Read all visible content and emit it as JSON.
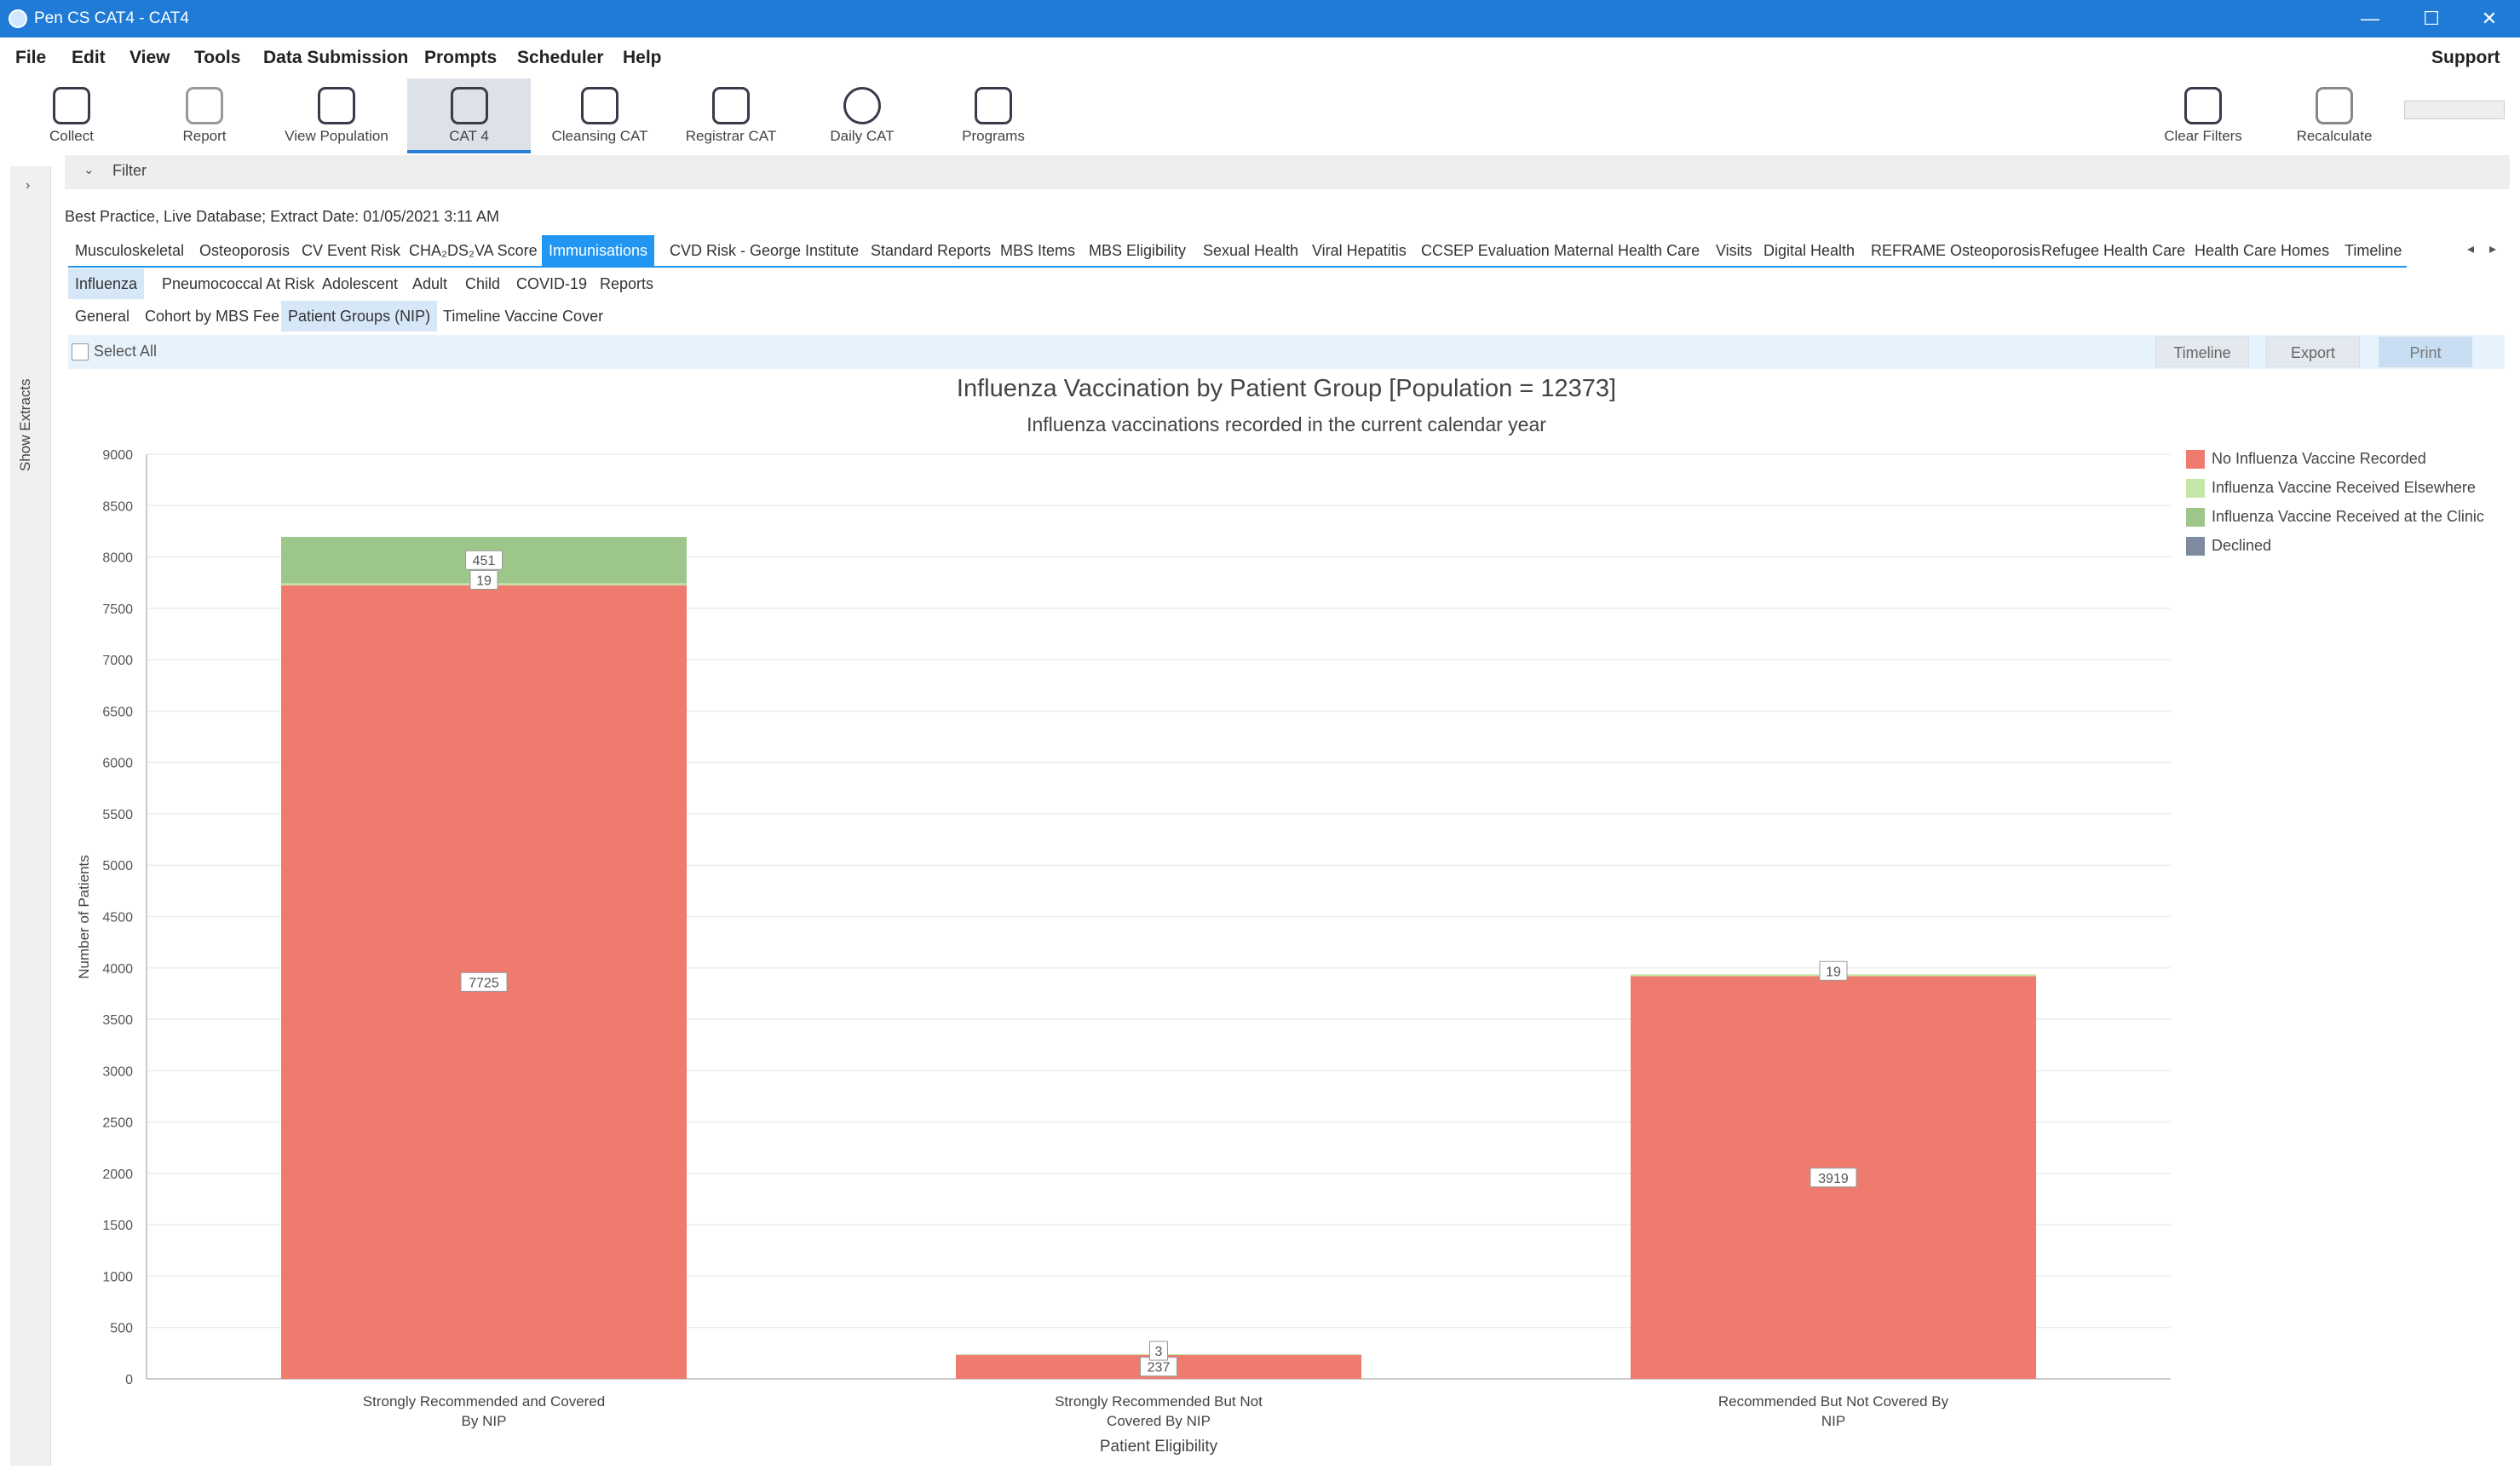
{
  "window": {
    "title": "Pen CS CAT4 - CAT4",
    "minimize": "—",
    "maximize": "☐",
    "close": "✕"
  },
  "menu": {
    "items": [
      "File",
      "Edit",
      "View",
      "Tools",
      "Data Submission",
      "Prompts",
      "Scheduler",
      "Help"
    ],
    "support": "Support"
  },
  "toolbar": {
    "tools": [
      {
        "label": "Collect",
        "icon": "cart-icon"
      },
      {
        "label": "Report",
        "icon": "report-icon"
      },
      {
        "label": "View Population",
        "icon": "population-icon"
      },
      {
        "label": "CAT 4",
        "icon": "cat4-icon",
        "active": true
      },
      {
        "label": "Cleansing CAT",
        "icon": "cleansing-icon"
      },
      {
        "label": "Registrar CAT",
        "icon": "registrar-icon"
      },
      {
        "label": "Daily CAT",
        "icon": "daily-cat-icon"
      },
      {
        "label": "Programs",
        "icon": "programs-icon"
      }
    ],
    "right_tools": [
      {
        "label": "Clear Filters",
        "icon": "eraser-icon"
      },
      {
        "label": "Recalculate",
        "icon": "calculator-icon"
      }
    ]
  },
  "sidebar": {
    "show_extracts": "Show Extracts",
    "arrow": "›"
  },
  "filter": {
    "label": "Filter",
    "chevron": "⌄"
  },
  "extract_info": "Best Practice, Live Database; Extract Date: 01/05/2021 3:11 AM",
  "tabs_main": [
    "Musculoskeletal",
    "Osteoporosis",
    "CV Event Risk",
    "CHA₂DS₂VA Score",
    "Immunisations",
    "CVD Risk - George Institute",
    "Standard Reports",
    "MBS Items",
    "MBS Eligibility",
    "Sexual Health",
    "Viral Hepatitis",
    "CCSEP Evaluation",
    "Maternal Health Care",
    "Visits",
    "Digital Health",
    "REFRAME Osteoporosis",
    "Refugee Health Care",
    "Health Care Homes",
    "Timeline"
  ],
  "tabs_main_active": "Immunisations",
  "tabs_main_nav": {
    "prev": "◂",
    "next": "▸"
  },
  "tabs_imm": [
    "Influenza",
    "Pneumococcal At Risk",
    "Adolescent",
    "Adult",
    "Child",
    "COVID-19",
    "Reports"
  ],
  "tabs_imm_active": "Influenza",
  "tabs_flu": [
    "General",
    "Cohort by MBS Fee",
    "Patient Groups (NIP)",
    "Timeline Vaccine Cover"
  ],
  "tabs_flu_active": "Patient Groups (NIP)",
  "actions": {
    "select_all": "Select All",
    "timeline": "Timeline",
    "export": "Export",
    "print": "Print"
  },
  "colors": {
    "no_vaccine": "#ef7b6f",
    "elsewhere": "#c4e7a8",
    "at_clinic": "#9dc68a",
    "declined": "#7d8aa0",
    "accent": "#2196f3"
  },
  "chart_data": {
    "type": "bar",
    "stacked": true,
    "title": "Influenza Vaccination by Patient Group [Population = 12373]",
    "subtitle": "Influenza vaccinations recorded in the current calendar year",
    "xlabel": "Patient Eligibility",
    "ylabel": "Number of Patients",
    "ylim": [
      0,
      9000
    ],
    "yticks": [
      0,
      500,
      1000,
      1500,
      2000,
      2500,
      3000,
      3500,
      4000,
      4500,
      5000,
      5500,
      6000,
      6500,
      7000,
      7500,
      8000,
      8500,
      9000
    ],
    "grid": true,
    "legend_position": "top-right",
    "categories": [
      [
        "Strongly Recommended and Covered",
        "By NIP"
      ],
      [
        "Strongly Recommended But Not",
        "Covered By NIP"
      ],
      [
        "Recommended But Not Covered By",
        "NIP"
      ]
    ],
    "series": [
      {
        "name": "No Influenza Vaccine Recorded",
        "color": "#ef7b6f",
        "values": [
          7725,
          237,
          3919
        ],
        "labels": [
          "7725",
          "237",
          "3919"
        ]
      },
      {
        "name": "Influenza Vaccine Received Elsewhere",
        "color": "#c4e7a8",
        "values": [
          19,
          3,
          19
        ],
        "labels": [
          "19",
          "3",
          "19"
        ]
      },
      {
        "name": "Influenza Vaccine Received at the Clinic",
        "color": "#9dc68a",
        "values": [
          451,
          0,
          0
        ],
        "labels": [
          "451",
          "",
          ""
        ]
      },
      {
        "name": "Declined",
        "color": "#7d8aa0",
        "values": [
          0,
          0,
          0
        ],
        "labels": [
          "",
          "",
          ""
        ]
      }
    ]
  }
}
